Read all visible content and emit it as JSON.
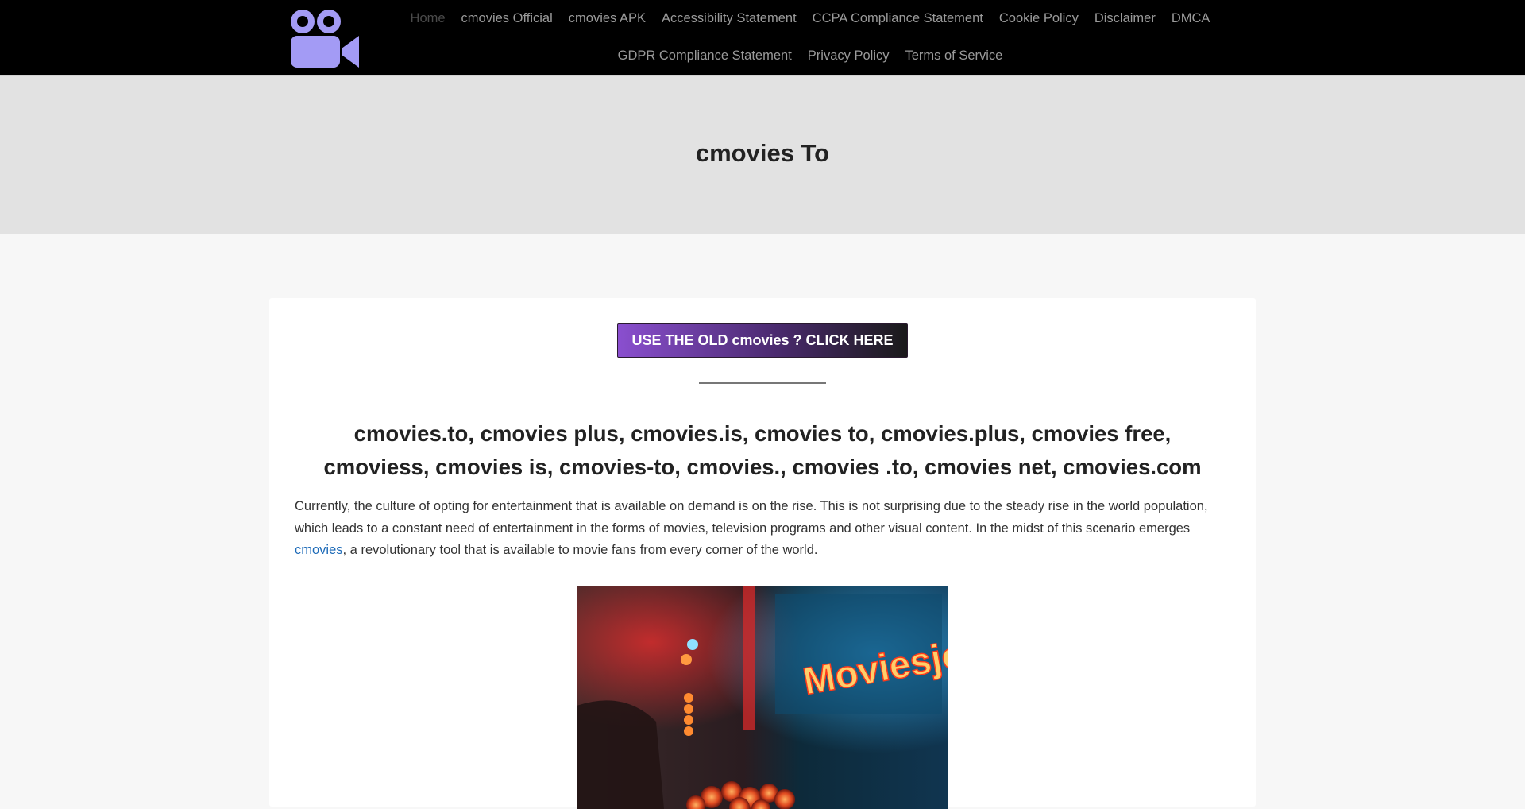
{
  "header": {
    "logo_icon": "video-camera-icon",
    "logo_color": "#a39bf5",
    "nav": [
      {
        "label": "Home",
        "current": true
      },
      {
        "label": "cmovies Official"
      },
      {
        "label": "cmovies APK"
      },
      {
        "label": "Accessibility Statement"
      },
      {
        "label": "CCPA Compliance Statement"
      },
      {
        "label": "Cookie Policy"
      },
      {
        "label": "Disclaimer"
      },
      {
        "label": "DMCA"
      },
      {
        "label": "GDPR Compliance Statement"
      },
      {
        "label": "Privacy Policy"
      },
      {
        "label": "Terms of Service"
      }
    ]
  },
  "hero": {
    "title": "cmovies To"
  },
  "content": {
    "old_button_label": "USE THE OLD cmovies ? CLICK HERE",
    "heading": "cmovies.to, cmovies plus, cmovies.is, cmovies to, cmovies.plus, cmovies free, cmoviess, cmovies is, cmovies-to, cmovies., cmovies .to, cmovies net, cmovies.com",
    "intro_before_link": "Currently, the culture of opting for entertainment that is available on demand is on the rise. This is not surprising due to the steady rise in the world population, which leads to a constant need of entertainment in the forms of movies, television programs and other visual content. In the midst of this scenario emerges ",
    "intro_link": "cmovies",
    "intro_after_link": ", a revolutionary tool that is available to movie fans from every corner of the world.",
    "image_sign_text": "Moviesjoy"
  },
  "colors": {
    "header_bg": "#000000",
    "hero_bg": "#e2e2e2",
    "link": "#1e6bb8",
    "button_start": "#8a4fcf",
    "button_end": "#1a1a1a"
  }
}
